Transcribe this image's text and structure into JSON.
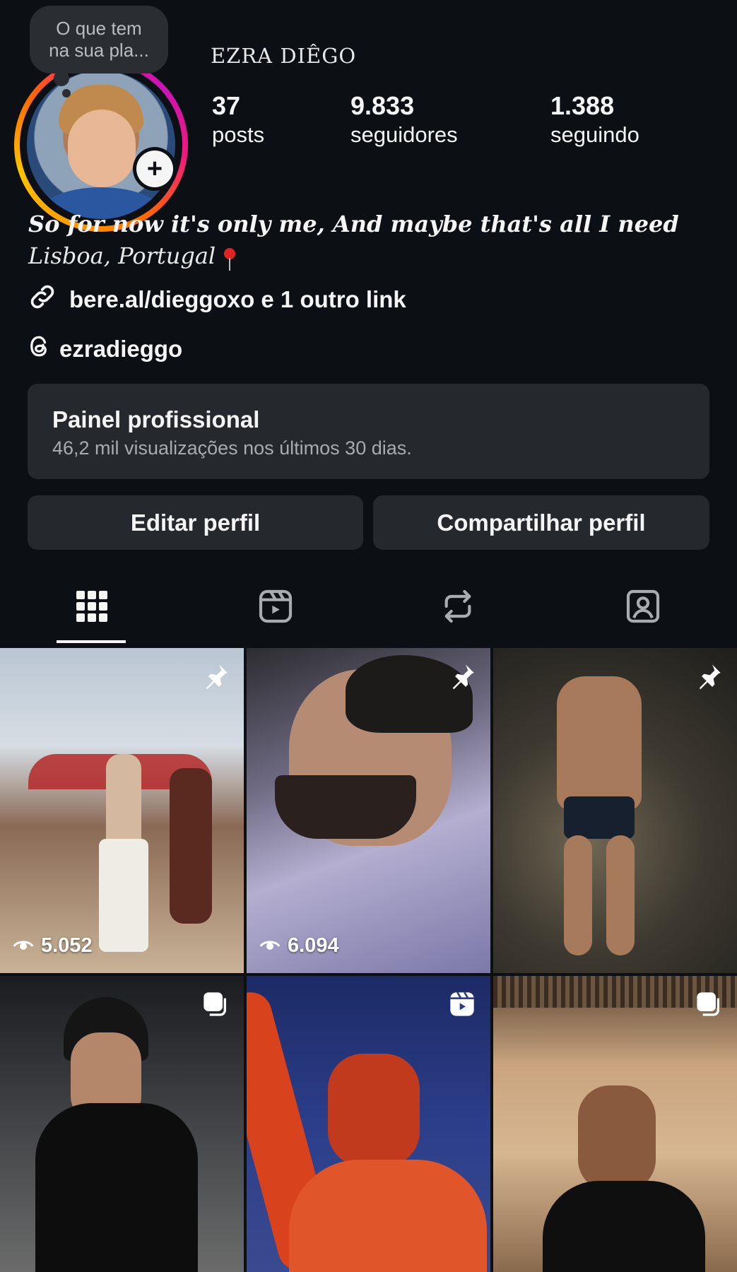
{
  "profile": {
    "note": [
      "O que tem",
      "na sua pla..."
    ],
    "username": "EZRA DIÊGO",
    "stats": [
      {
        "value": "37",
        "label": "posts"
      },
      {
        "value": "9.833",
        "label": "seguidores"
      },
      {
        "value": "1.388",
        "label": "seguindo"
      }
    ],
    "bio": "So for now it's only me, And maybe that's all I need",
    "location": "Lisboa, Portugal",
    "link": "bere.al/dieggoxo e 1 outro link",
    "threads": "ezradieggo"
  },
  "dashboard": {
    "title": "Painel profissional",
    "subtitle": "46,2 mil visualizações nos últimos 30 dias."
  },
  "actions": {
    "edit": "Editar perfil",
    "share": "Compartilhar perfil"
  },
  "tabs": [
    {
      "icon": "grid-icon",
      "active": true
    },
    {
      "icon": "reels-icon",
      "active": false
    },
    {
      "icon": "reposts-icon",
      "active": false
    },
    {
      "icon": "tagged-icon",
      "active": false
    }
  ],
  "posts": [
    {
      "overlay": "pin-icon",
      "views": "5.052"
    },
    {
      "overlay": "pin-icon",
      "views": "6.094"
    },
    {
      "overlay": "pin-icon",
      "views": ""
    },
    {
      "overlay": "carousel-icon",
      "views": ""
    },
    {
      "overlay": "reel-icon",
      "views": ""
    },
    {
      "overlay": "carousel-icon",
      "views": ""
    }
  ],
  "colors": {
    "background": "#0c1014",
    "card": "#25292e",
    "text": "#f5f5f5",
    "muted": "#a8abaf"
  }
}
